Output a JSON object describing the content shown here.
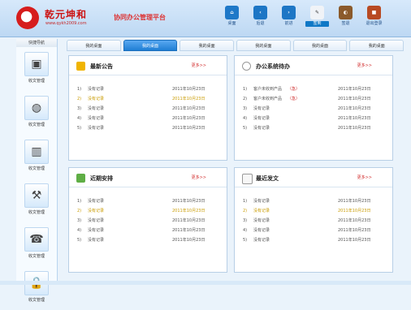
{
  "header": {
    "brand": "乾元坤和",
    "url": "www.qykh2009.com",
    "system": "协同办公管理平台"
  },
  "topnav": [
    {
      "label": "桌面",
      "icon": "home-icon",
      "color": "#1e78c8"
    },
    {
      "label": "后退",
      "icon": "back-icon",
      "color": "#1d76c5"
    },
    {
      "label": "前进",
      "icon": "forward-icon",
      "color": "#1d76c5"
    },
    {
      "label": "签到",
      "icon": "sign-icon",
      "color": "#f0f3f7",
      "active": true
    },
    {
      "label": "签退",
      "icon": "bag-icon",
      "color": "#8b5a2b"
    },
    {
      "label": "退出登录",
      "icon": "logout-icon",
      "color": "#b84a23"
    }
  ],
  "sidebar": {
    "title": "快捷导航",
    "items": [
      {
        "label": "收文管理",
        "icon": "computer-icon"
      },
      {
        "label": "收文管理",
        "icon": "globe-icon"
      },
      {
        "label": "收文管理",
        "icon": "chart-icon"
      },
      {
        "label": "收文管理",
        "icon": "tools-icon"
      },
      {
        "label": "收文管理",
        "icon": "phone-icon"
      },
      {
        "label": "收文管理",
        "icon": "lock-icon"
      }
    ]
  },
  "tabs": [
    {
      "label": "我的桌面"
    },
    {
      "label": "我的桌面",
      "active": true
    },
    {
      "label": "我的桌面"
    },
    {
      "label": "我的桌面"
    },
    {
      "label": "我的桌面"
    },
    {
      "label": "我的桌面"
    }
  ],
  "panels": [
    {
      "title": "最新公告",
      "more": "更多>>",
      "icon": "announcement-icon",
      "rows": [
        {
          "num": "1)",
          "text": "没有记录",
          "date": "2011年10月23日"
        },
        {
          "num": "2)",
          "text": "没有记录",
          "date": "2011年10月23日",
          "highlight": true
        },
        {
          "num": "3)",
          "text": "没有记录",
          "date": "2011年10月23日"
        },
        {
          "num": "4)",
          "text": "没有记录",
          "date": "2011年10月23日"
        },
        {
          "num": "5)",
          "text": "没有记录",
          "date": "2011年10月23日"
        }
      ]
    },
    {
      "title": "办公系统待办",
      "more": "更多>>",
      "icon": "clock-icon",
      "rows": [
        {
          "num": "1)",
          "text": "客户未收到产品",
          "urgent": "（急）",
          "date": "2011年10月23日"
        },
        {
          "num": "2)",
          "text": "客户未收到产品",
          "urgent": "（急）",
          "date": "2011年10月23日"
        },
        {
          "num": "3)",
          "text": "没有记录",
          "date": "2011年10月23日"
        },
        {
          "num": "4)",
          "text": "没有记录",
          "date": "2011年10月23日"
        },
        {
          "num": "5)",
          "text": "没有记录",
          "date": "2011年10月23日"
        }
      ]
    },
    {
      "title": "近期安排",
      "more": "更多>>",
      "icon": "schedule-icon",
      "rows": [
        {
          "num": "1)",
          "text": "没有记录",
          "date": "2011年10月23日"
        },
        {
          "num": "2)",
          "text": "没有记录",
          "date": "2011年10月23日",
          "highlight": true
        },
        {
          "num": "3)",
          "text": "没有记录",
          "date": "2011年10月23日"
        },
        {
          "num": "4)",
          "text": "没有记录",
          "date": "2011年10月23日"
        },
        {
          "num": "5)",
          "text": "没有记录",
          "date": "2011年10月23日"
        }
      ]
    },
    {
      "title": "最近发文",
      "more": "更多>>",
      "icon": "document-icon",
      "rows": [
        {
          "num": "1)",
          "text": "没有记录",
          "date": "2011年10月23日"
        },
        {
          "num": "2)",
          "text": "没有记录",
          "date": "2011年10月23日",
          "highlight": true
        },
        {
          "num": "3)",
          "text": "没有记录",
          "date": "2011年10月23日"
        },
        {
          "num": "4)",
          "text": "没有记录",
          "date": "2011年10月23日"
        },
        {
          "num": "5)",
          "text": "没有记录",
          "date": "2011年10月23日"
        }
      ]
    }
  ]
}
